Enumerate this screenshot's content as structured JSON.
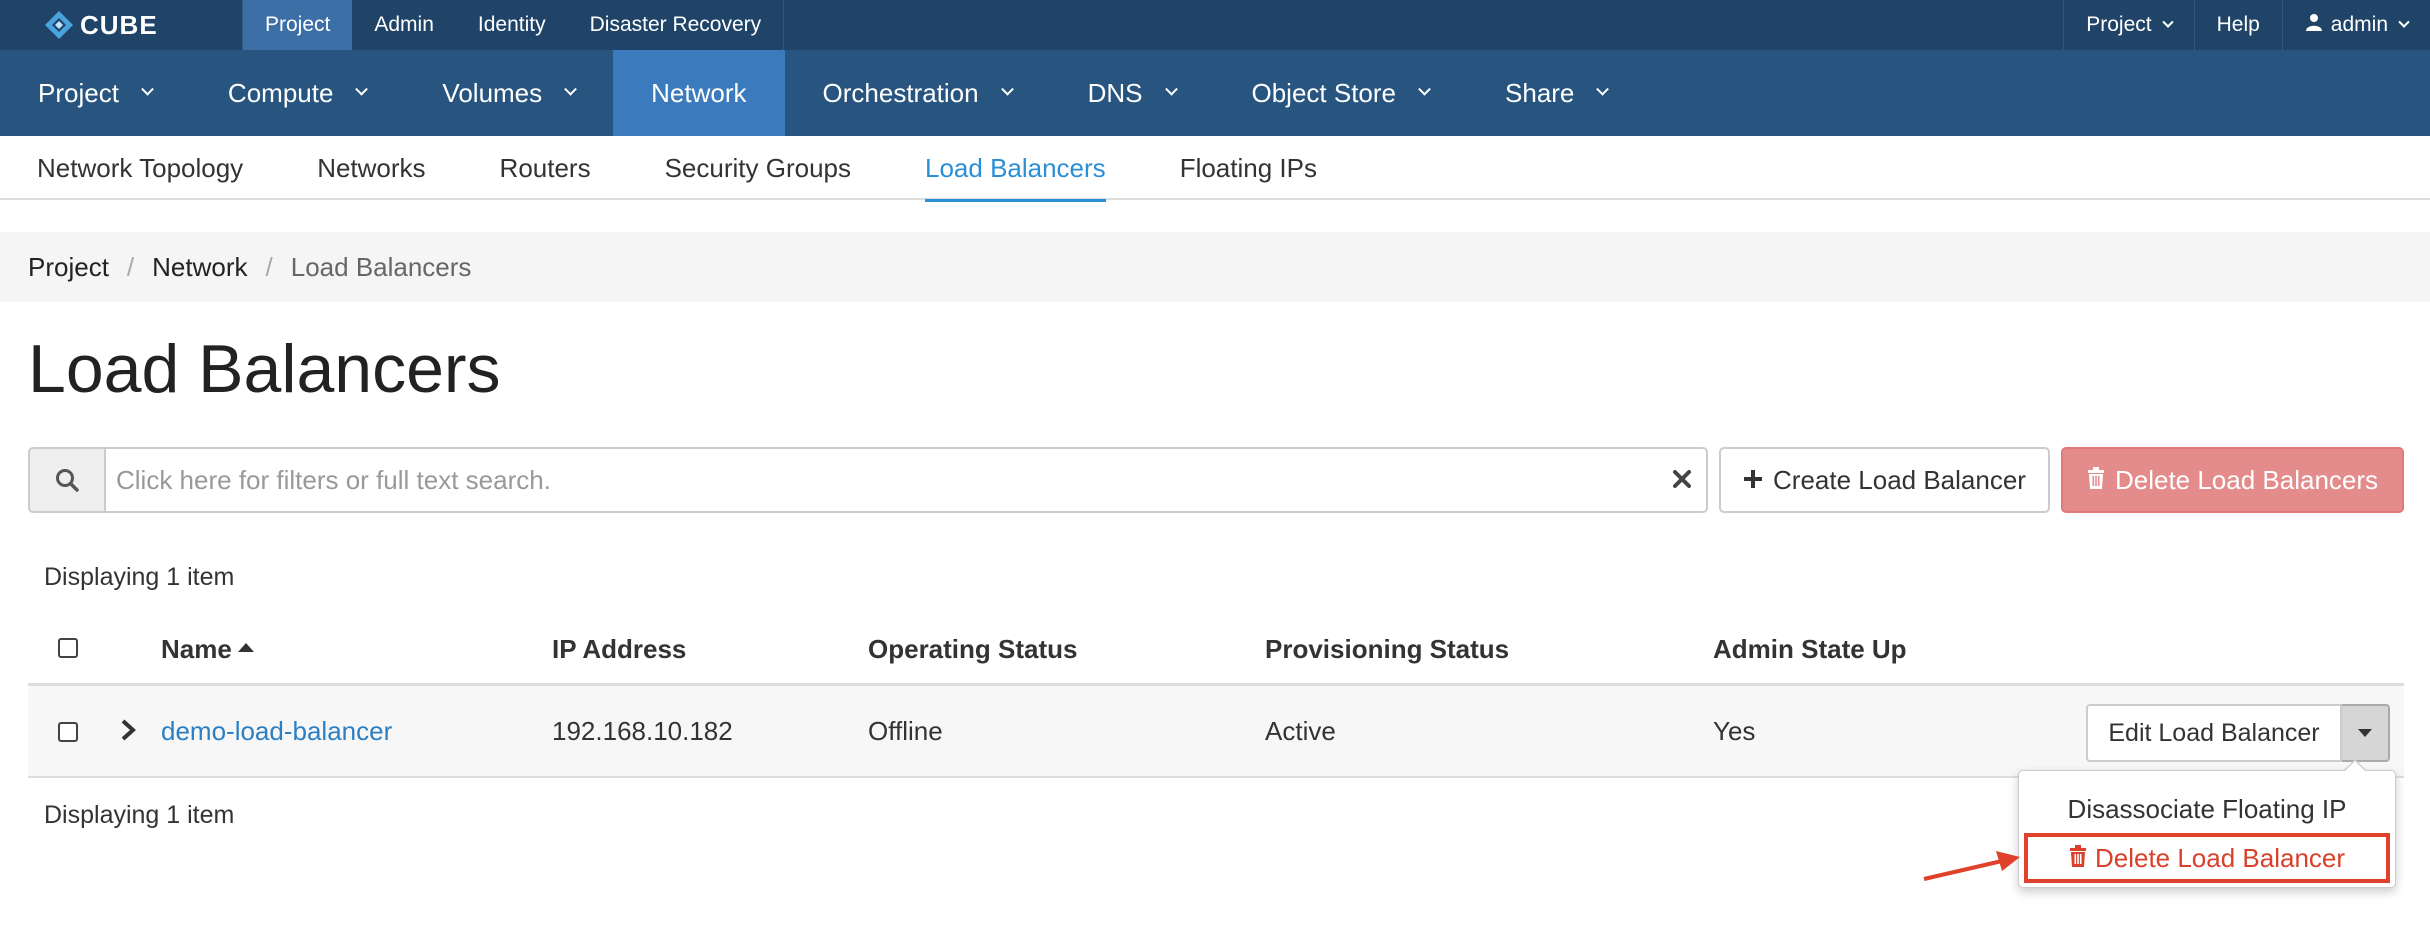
{
  "brand": {
    "name": "CUBE"
  },
  "topnav": [
    {
      "label": "Project",
      "active": true
    },
    {
      "label": "Admin",
      "active": false
    },
    {
      "label": "Identity",
      "active": false
    },
    {
      "label": "Disaster Recovery",
      "active": false
    }
  ],
  "topright": {
    "project": "Project",
    "help": "Help",
    "user": "admin"
  },
  "mainnav": [
    {
      "label": "Project",
      "dropdown": true
    },
    {
      "label": "Compute",
      "dropdown": true
    },
    {
      "label": "Volumes",
      "dropdown": true
    },
    {
      "label": "Network",
      "dropdown": false,
      "active": true
    },
    {
      "label": "Orchestration",
      "dropdown": true
    },
    {
      "label": "DNS",
      "dropdown": true
    },
    {
      "label": "Object Store",
      "dropdown": true
    },
    {
      "label": "Share",
      "dropdown": true
    }
  ],
  "subnav": [
    {
      "label": "Network Topology"
    },
    {
      "label": "Networks"
    },
    {
      "label": "Routers"
    },
    {
      "label": "Security Groups"
    },
    {
      "label": "Load Balancers",
      "active": true
    },
    {
      "label": "Floating IPs"
    }
  ],
  "breadcrumb": [
    "Project",
    "Network",
    "Load Balancers"
  ],
  "page": {
    "title": "Load Balancers"
  },
  "search": {
    "placeholder": "Click here for filters or full text search."
  },
  "actions": {
    "create": "Create Load Balancer",
    "delete_all": "Delete Load Balancers"
  },
  "table": {
    "count_top": "Displaying 1 item",
    "count_bottom": "Displaying 1 item",
    "headers": {
      "name": "Name",
      "ip": "IP Address",
      "operating": "Operating Status",
      "provisioning": "Provisioning Status",
      "admin": "Admin State Up"
    },
    "rows": [
      {
        "name": "demo-load-balancer",
        "ip": "192.168.10.182",
        "operating": "Offline",
        "provisioning": "Active",
        "admin": "Yes",
        "edit": "Edit Load Balancer"
      }
    ]
  },
  "dropdown": {
    "items": [
      "Disassociate Floating IP",
      "Delete Load Balancer"
    ]
  },
  "colors": {
    "topbar": "#1f4468",
    "mainnav": "#27557f",
    "accent": "#2b8fd6",
    "danger": "#d9412a",
    "danger_button": "#e48b8b"
  }
}
